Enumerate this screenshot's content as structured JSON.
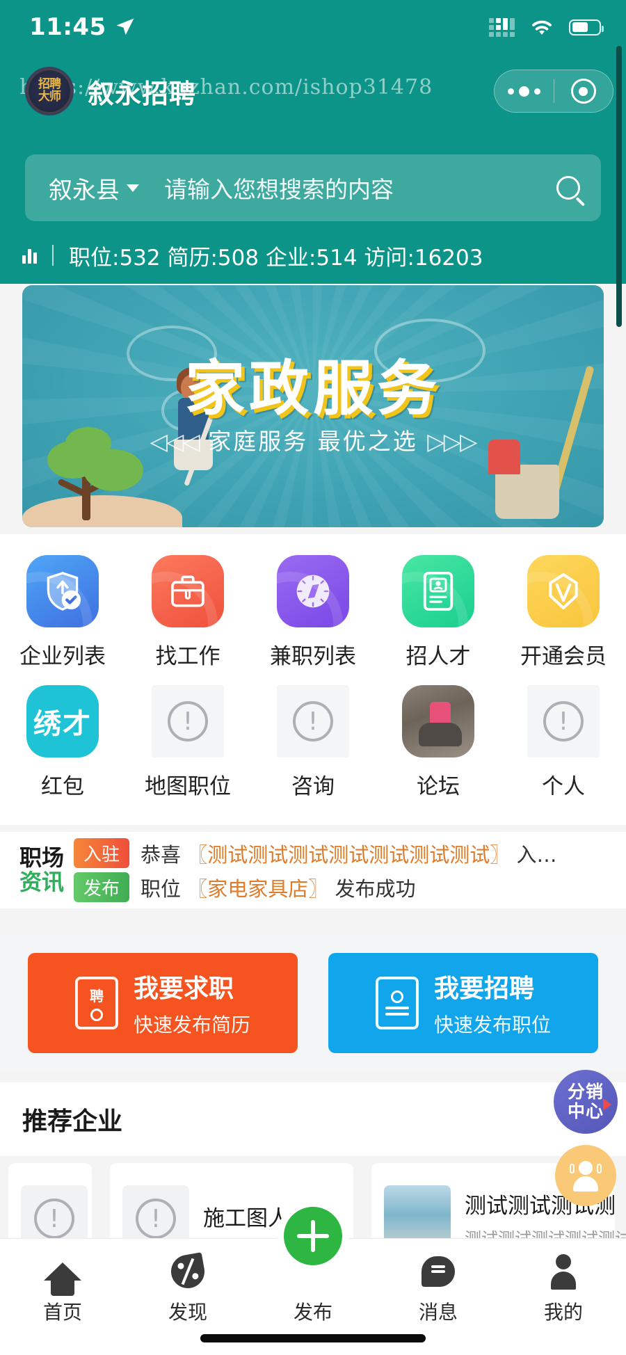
{
  "status_bar": {
    "time": "11:45",
    "location_icon": "location-arrow-icon",
    "signal_icon": "signal-dots-icon",
    "wifi_icon": "wifi-icon",
    "battery_icon": "battery-icon"
  },
  "header": {
    "logo_line1": "招聘",
    "logo_line2": "大师",
    "title": "叙永招聘",
    "watermark": "https://www.kuzhan.com/ishop31478",
    "capsule": {
      "more_icon": "more-dots-icon",
      "close_icon": "target-circle-icon"
    }
  },
  "search": {
    "city": "叙永县",
    "placeholder": "请输入您想搜索的内容",
    "search_icon": "search-icon",
    "caret_icon": "chevron-down-icon"
  },
  "stats": {
    "chart_icon": "bar-chart-icon",
    "items": [
      {
        "label": "职位",
        "value": "532"
      },
      {
        "label": "简历",
        "value": "508"
      },
      {
        "label": "企业",
        "value": "514"
      },
      {
        "label": "访问",
        "value": "16203"
      }
    ],
    "text": "职位:532 简历:508 企业:514 访问:16203"
  },
  "banner": {
    "title": "家政服务",
    "subtitle": "◁◁◁ 家庭服务 最优之选 ▷▷▷",
    "subtitle_left_arrows": "◁◁◁",
    "subtitle_text": "家庭服务 最优之选",
    "subtitle_right_arrows": "▷▷▷"
  },
  "grid": {
    "row1": [
      {
        "label": "企业列表",
        "icon": "shield-check-icon",
        "color": "#3f6fe0"
      },
      {
        "label": "找工作",
        "icon": "briefcase-icon",
        "color": "#f0503c"
      },
      {
        "label": "兼职列表",
        "icon": "compass-icon",
        "color": "#7a47e6"
      },
      {
        "label": "招人才",
        "icon": "id-card-icon",
        "color": "#19cf8e"
      },
      {
        "label": "开通会员",
        "icon": "diamond-icon",
        "color": "#f9c53b"
      }
    ],
    "row2": [
      {
        "label": "红包",
        "icon": "xiucai-text-icon",
        "text": "绣才",
        "color": "#1ec4d6"
      },
      {
        "label": "地图职位",
        "icon": "broken-image-icon"
      },
      {
        "label": "咨询",
        "icon": "broken-image-icon"
      },
      {
        "label": "论坛",
        "icon": "photo-thumbnail-icon"
      },
      {
        "label": "个人",
        "icon": "broken-image-icon"
      }
    ]
  },
  "news": {
    "logo_line1": "职场",
    "logo_line2": "资讯",
    "rows": [
      {
        "tag": "入驻",
        "prefix": "恭喜 ",
        "highlight": "〖测试测试测试测试测试测试测试〗",
        "suffix": " 入…"
      },
      {
        "tag": "发布",
        "prefix": "职位 ",
        "highlight": "〖家电家具店〗",
        "suffix": " 发布成功"
      }
    ]
  },
  "actions": [
    {
      "title": "我要求职",
      "subtitle": "快速发布简历",
      "icon": "resume-post-icon",
      "color": "#f5531f"
    },
    {
      "title": "我要招聘",
      "subtitle": "快速发布职位",
      "icon": "job-post-icon",
      "color": "#11a6ec"
    }
  ],
  "recommend": {
    "heading": "推荐企业"
  },
  "cards": [
    {
      "title": "",
      "subtitle": "",
      "thumb": "broken-image-icon",
      "partial": true
    },
    {
      "title": "施工图人",
      "subtitle": "",
      "thumb": "broken-image-icon",
      "partial": false
    },
    {
      "title": "测试测试测试测",
      "subtitle": "测试测试测试测试测试测试",
      "thumb": "sea-photo-icon",
      "partial": false
    }
  ],
  "floating": {
    "distribution": {
      "line1": "分销",
      "line2": "中心",
      "icon": "distribution-center-icon"
    },
    "service": {
      "icon": "customer-service-icon"
    }
  },
  "tabbar": [
    {
      "label": "首页",
      "icon": "home-icon",
      "active": true
    },
    {
      "label": "发现",
      "icon": "discover-icon",
      "active": false
    },
    {
      "label": "发布",
      "icon": "plus-publish-icon",
      "active": false
    },
    {
      "label": "消息",
      "icon": "message-icon",
      "active": false
    },
    {
      "label": "我的",
      "icon": "profile-icon",
      "active": false
    }
  ],
  "colors": {
    "brand_green": "#0d9488",
    "publish_green": "#2db742",
    "seek_orange": "#f5531f",
    "hire_blue": "#11a6ec"
  }
}
